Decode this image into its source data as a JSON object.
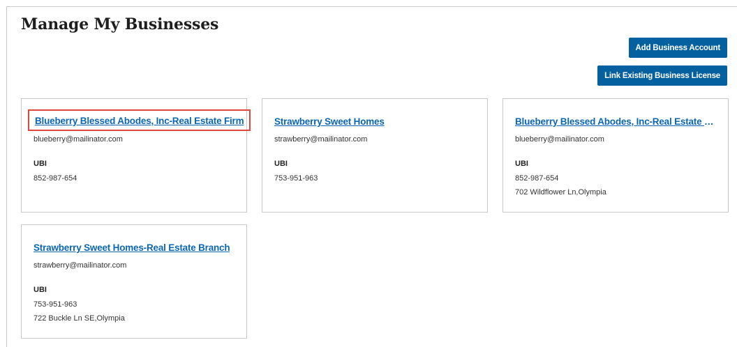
{
  "page": {
    "title": "Manage My Businesses"
  },
  "actions": {
    "add_business_label": "Add Business Account",
    "link_license_label": "Link Existing Business License"
  },
  "businesses": [
    {
      "name": "Blueberry Blessed Abodes, Inc-Real Estate Firm",
      "email": "blueberry@mailinator.com",
      "ubi_label": "UBI",
      "ubi": "852-987-654",
      "address": ""
    },
    {
      "name": "Strawberry Sweet Homes",
      "email": "strawberry@mailinator.com",
      "ubi_label": "UBI",
      "ubi": "753-951-963",
      "address": ""
    },
    {
      "name": "Blueberry Blessed Abodes, Inc-Real Estate Bra…",
      "email": "blueberry@mailinator.com",
      "ubi_label": "UBI",
      "ubi": "852-987-654",
      "address": "702 Wildflower Ln,Olympia"
    },
    {
      "name": "Strawberry Sweet Homes-Real Estate Branch",
      "email": "strawberry@mailinator.com",
      "ubi_label": "UBI",
      "ubi": "753-951-963",
      "address": "722 Buckle Ln SE,Olympia"
    }
  ],
  "colors": {
    "primary_button": "#04609e",
    "link": "#0b66b3",
    "highlight_border": "#e0463c",
    "card_border": "#c9c9c9"
  }
}
